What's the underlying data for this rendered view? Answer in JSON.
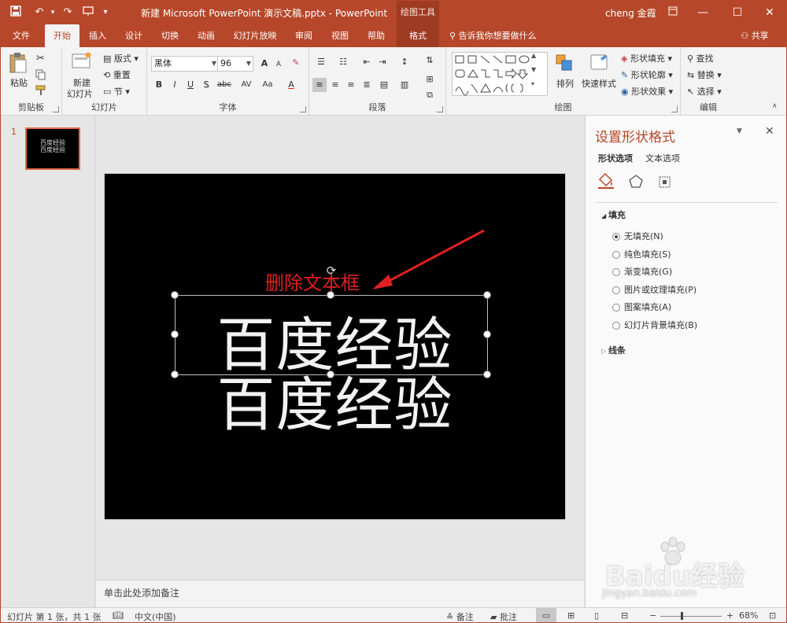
{
  "titlebar": {
    "document_title": "新建 Microsoft PowerPoint 演示文稿.pptx  -  PowerPoint",
    "context_group": "绘图工具",
    "user": "cheng 金霞"
  },
  "tabs": [
    "文件",
    "开始",
    "插入",
    "设计",
    "切换",
    "动画",
    "幻灯片放映",
    "审阅",
    "视图",
    "帮助",
    "格式"
  ],
  "tell_me": "告诉我你想要做什么",
  "share": "共享",
  "ribbon": {
    "clipboard": {
      "paste": "粘贴",
      "label": "剪贴板"
    },
    "slides": {
      "new_slide_1": "新建",
      "new_slide_2": "幻灯片",
      "layout": "版式",
      "reset": "重置",
      "section": "节",
      "label": "幻灯片"
    },
    "font": {
      "font_name": "黑体",
      "font_size": "96",
      "bold": "B",
      "italic": "I",
      "underline": "U",
      "shadow": "S",
      "strike": "abc",
      "spacing": "AV",
      "case": "Aa",
      "color": "A",
      "grow": "A",
      "shrink": "A",
      "label": "字体"
    },
    "paragraph": {
      "label": "段落"
    },
    "drawing": {
      "arrange": "排列",
      "quick_styles": "快速样式",
      "fill": "形状填充",
      "outline": "形状轮廓",
      "effects": "形状效果",
      "label": "绘图"
    },
    "editing": {
      "find": "查找",
      "replace": "替换",
      "select": "选择",
      "label": "编辑"
    }
  },
  "thumbnail": {
    "number": "1",
    "line1": "百度经验",
    "line2": "百度经验"
  },
  "slide": {
    "text1": "百度经验",
    "text2": "百度经验",
    "annotation": "删除文本框"
  },
  "notes_placeholder": "单击此处添加备注",
  "format_pane": {
    "title": "设置形状格式",
    "tab_shape": "形状选项",
    "tab_text": "文本选项",
    "fill_section": "填充",
    "options": [
      "无填充(N)",
      "纯色填充(S)",
      "渐变填充(G)",
      "图片或纹理填充(P)",
      "图案填充(A)",
      "幻灯片背景填充(B)"
    ],
    "selected_index": 0,
    "line_section": "线条"
  },
  "status": {
    "slide_info": "幻灯片 第 1 张，共 1 张",
    "language": "中文(中国)",
    "notes": "备注",
    "comments": "批注",
    "zoom": "68%",
    "zoom_level": 0.68
  },
  "watermark": {
    "brand": "Baidu经验",
    "url": "jingyan.baidu.com"
  },
  "colors": {
    "accent": "#b7472a",
    "annotation": "#e02020"
  }
}
